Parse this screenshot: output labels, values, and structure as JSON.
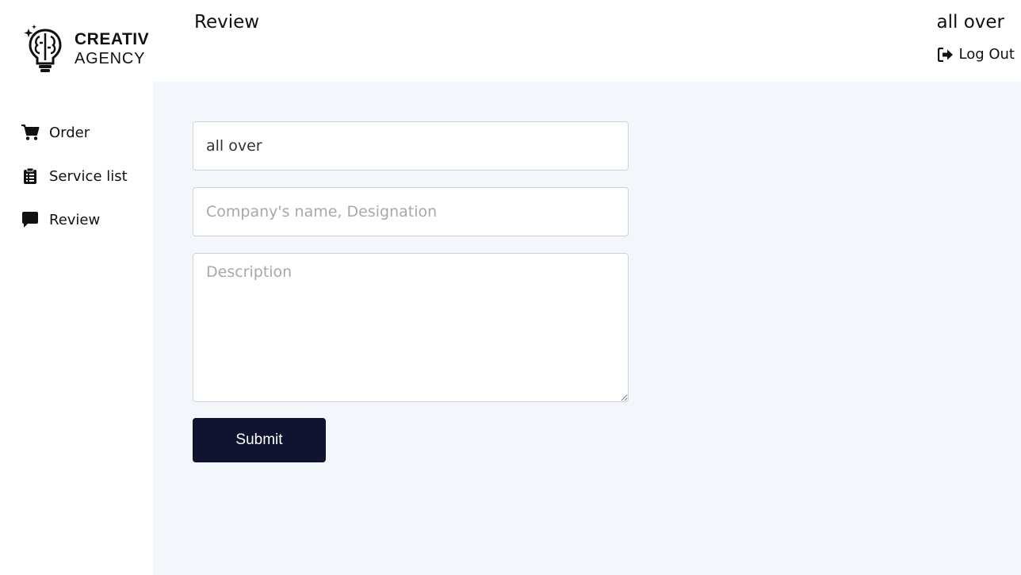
{
  "logo": {
    "line1": "CREATIV",
    "line2": "AGENCY"
  },
  "sidebar": {
    "items": [
      {
        "label": "Order",
        "icon": "cart-icon"
      },
      {
        "label": "Service list",
        "icon": "clipboard-icon"
      },
      {
        "label": "Review",
        "icon": "comment-icon"
      }
    ]
  },
  "header": {
    "title": "Review",
    "user_name": "all over",
    "logout_label": "Log Out"
  },
  "form": {
    "name_value": "all over",
    "company_placeholder": "Company's name, Designation",
    "description_placeholder": "Description",
    "submit_label": "Submit"
  },
  "colors": {
    "main_bg": "#f3f6fb",
    "button_bg": "#111430",
    "text": "#111111"
  }
}
